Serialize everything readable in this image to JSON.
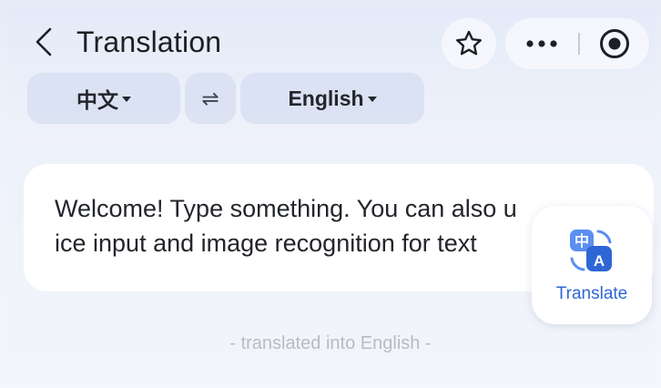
{
  "header": {
    "title": "Translation",
    "icons": {
      "back": "chevron-left-icon",
      "favorite": "star-icon",
      "more": "more-dots-icon",
      "record": "record-icon"
    }
  },
  "language_bar": {
    "source_language": "中文",
    "target_language": "English",
    "swap_symbol": "⇌"
  },
  "input": {
    "text": "Welcome! Type something. You can also u   \nice input and image recognition for text"
  },
  "translate_button": {
    "label": "Translate",
    "icon": "translate-icon",
    "glyph_top": "中",
    "glyph_bottom": "A"
  },
  "hint": "- translated into English -",
  "colors": {
    "accent": "#2f66d6",
    "background": "#eef2fa",
    "hint_text": "#b7bbc3"
  }
}
